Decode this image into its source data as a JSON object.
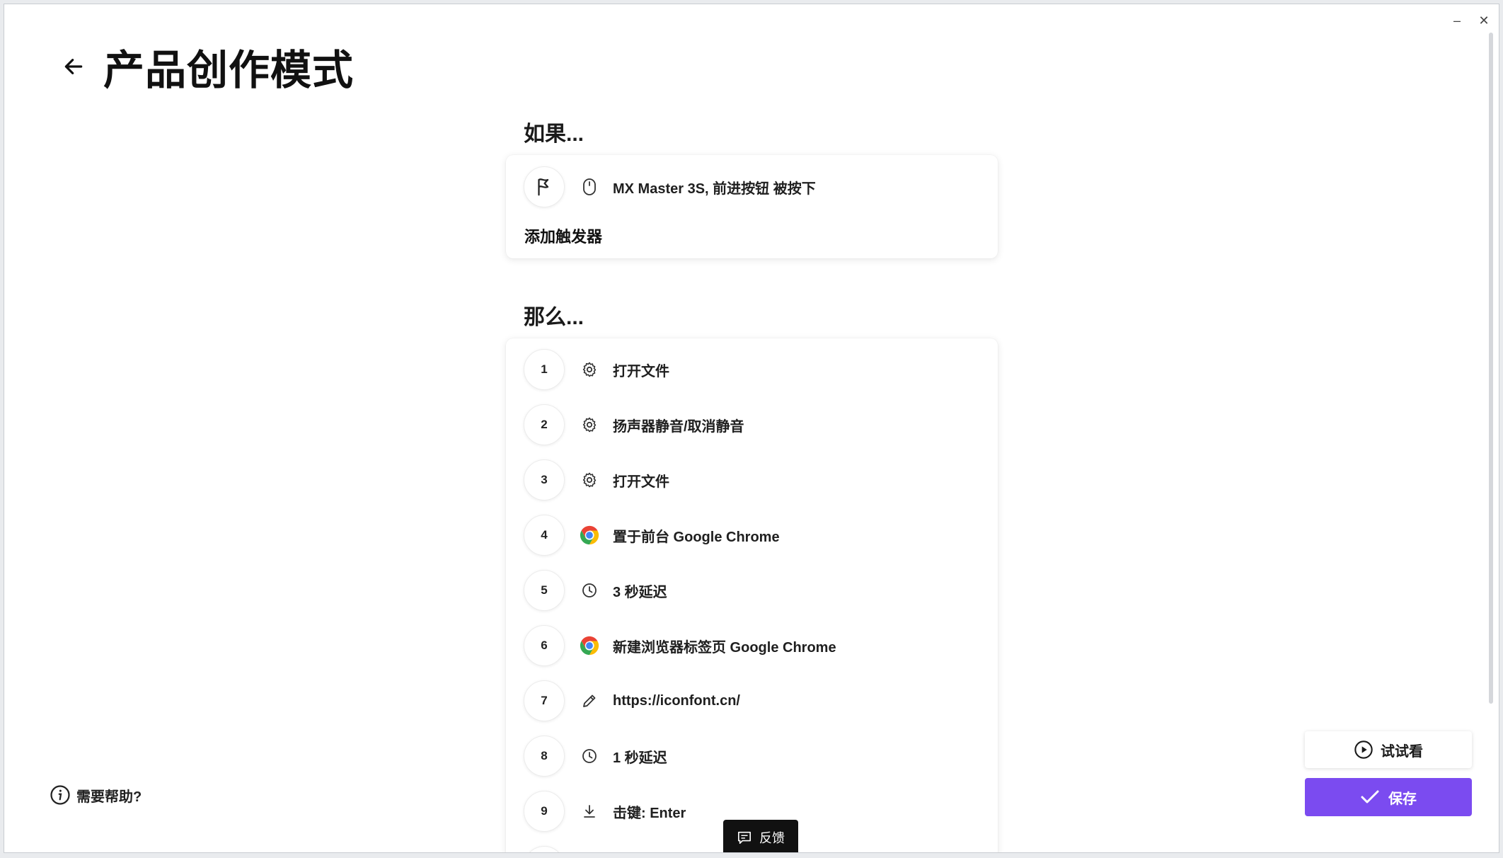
{
  "window": {
    "minimize_glyph": "–",
    "close_glyph": "✕"
  },
  "header": {
    "title": "产品创作模式"
  },
  "if_section": {
    "label": "如果...",
    "trigger": {
      "icon": "mouse-icon",
      "text": "MX Master 3S, 前进按钮 被按下"
    },
    "add_trigger_label": "添加触发器"
  },
  "then_section": {
    "label": "那么...",
    "actions": [
      {
        "num": "1",
        "icon": "gear-icon",
        "text": "打开文件"
      },
      {
        "num": "2",
        "icon": "gear-icon",
        "text": "扬声器静音/取消静音"
      },
      {
        "num": "3",
        "icon": "gear-icon",
        "text": "打开文件"
      },
      {
        "num": "4",
        "icon": "chrome-icon",
        "text": "置于前台 Google Chrome"
      },
      {
        "num": "5",
        "icon": "clock-icon",
        "text": "3 秒延迟"
      },
      {
        "num": "6",
        "icon": "chrome-icon",
        "text": "新建浏览器标签页 Google Chrome"
      },
      {
        "num": "7",
        "icon": "pencil-icon",
        "text": "https://iconfont.cn/"
      },
      {
        "num": "8",
        "icon": "clock-icon",
        "text": "1 秒延迟"
      },
      {
        "num": "9",
        "icon": "download-arrow-icon",
        "text": "击键: Enter"
      }
    ]
  },
  "help": {
    "label": "需要帮助?"
  },
  "feedback": {
    "label": "反馈"
  },
  "buttons": {
    "try_label": "试试看",
    "save_label": "保存"
  },
  "colors": {
    "accent": "#7b4bf0",
    "feedback_bg": "#111111"
  }
}
